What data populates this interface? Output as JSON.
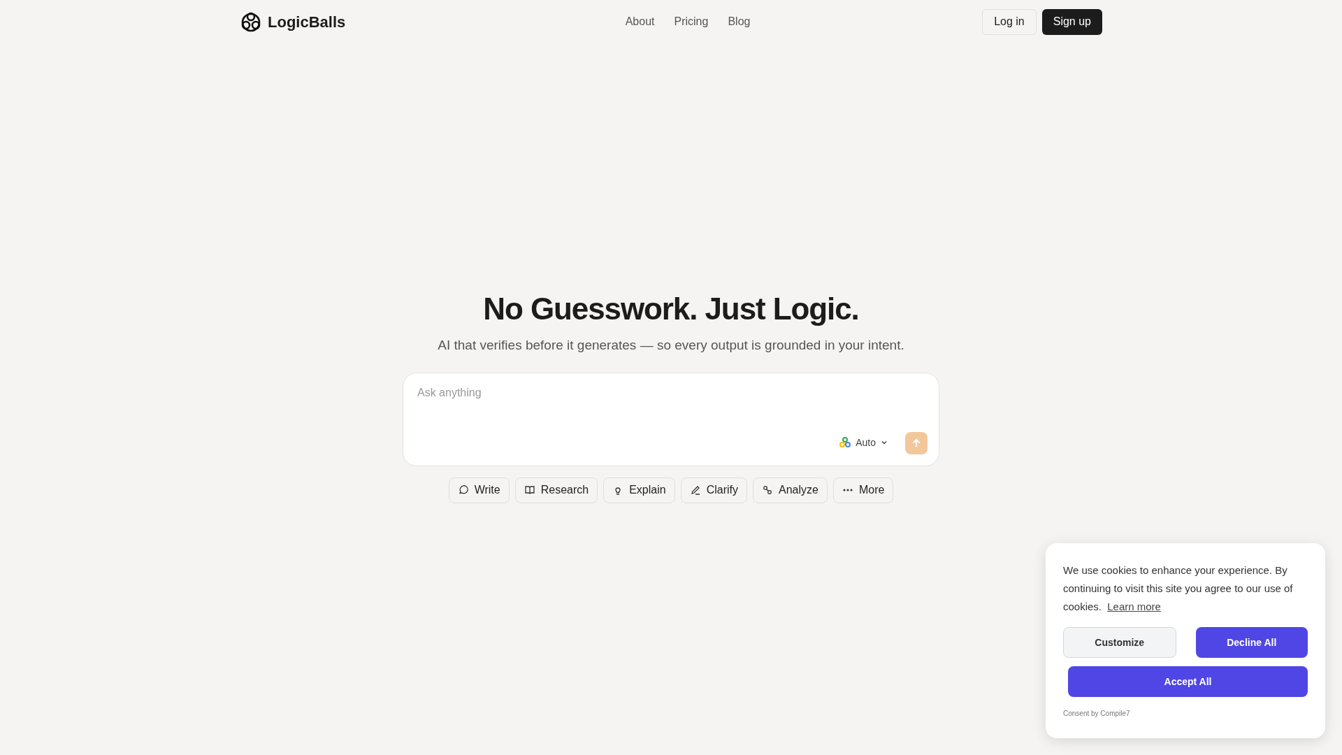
{
  "header": {
    "logo": "LogicBalls",
    "nav": [
      "About",
      "Pricing",
      "Blog"
    ],
    "login": "Log in",
    "signup": "Sign up"
  },
  "hero": {
    "title": "No Guesswork. Just Logic.",
    "subtitle": "AI that verifies before it generates — so every output is grounded in your intent."
  },
  "prompt": {
    "placeholder": "Ask anything",
    "model": "Auto"
  },
  "actions": [
    {
      "label": "Write",
      "kind": "chat"
    },
    {
      "label": "Research",
      "kind": "book"
    },
    {
      "label": "Explain",
      "kind": "bulb"
    },
    {
      "label": "Clarify",
      "kind": "pen"
    },
    {
      "label": "Analyze",
      "kind": "nodes"
    },
    {
      "label": "More",
      "kind": "dots"
    }
  ],
  "cookie_banner": {
    "text": "We use cookies to enhance your experience. By continuing to visit this site you agree to our use of cookies.",
    "link": "Learn more",
    "customize": "Customize",
    "decline": "Decline All",
    "accept": "Accept All",
    "footer": "Consent by Compile7"
  }
}
